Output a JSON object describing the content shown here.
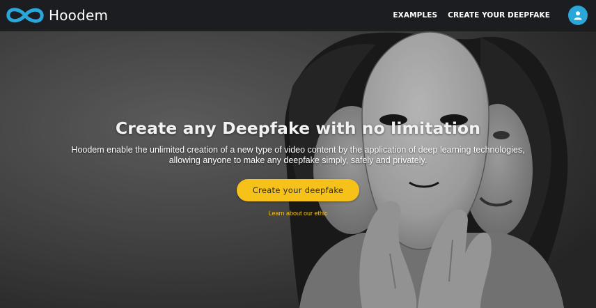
{
  "colors": {
    "nav_background": "#1c1d21",
    "brand_blue": "#2aa6d9",
    "accent_yellow": "#f6c21a"
  },
  "header": {
    "brand_name": "Hoodem",
    "logo_icon": "infinity-loop-logo",
    "nav_links": [
      {
        "label": "EXAMPLES"
      },
      {
        "label": "CREATE YOUR DEEPFAKE"
      }
    ],
    "account_icon": "user-icon"
  },
  "hero": {
    "title": "Create any Deepfake with no limitation",
    "description": "Hoodem enable the unlimited creation of a new type of video content by the application of deep learning technologies, allowing anyone to make any deepfake simply, safely and privately.",
    "cta_label": "Create your deepfake",
    "ethic_link": "Learn about our ethic",
    "background_image": "woman-holding-mask-photo"
  }
}
